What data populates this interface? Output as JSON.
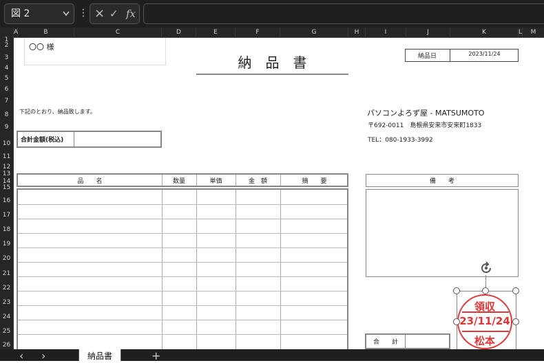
{
  "formula_bar": {
    "name_box": "図 2",
    "name_box_chevron": "chevron-down-icon",
    "more_icon": "⋮",
    "cancel_icon": "×",
    "enter_icon": "✓",
    "fx_label": "fx",
    "formula_value": ""
  },
  "columns": [
    "A",
    "B",
    "C",
    "D",
    "E",
    "F",
    "G",
    "H",
    "I",
    "J",
    "K",
    "L",
    "M"
  ],
  "rows": [
    "1",
    "2",
    "3",
    "4",
    "5",
    "6",
    "7",
    "8",
    "9",
    "10",
    "11",
    "12",
    "13",
    "14",
    "15",
    "16",
    "17",
    "18",
    "19",
    "20",
    "21",
    "22",
    "23",
    "24",
    "25",
    "26"
  ],
  "document": {
    "recipient": "〇〇 様",
    "title": "納　品　書",
    "date_label": "納品日",
    "date_value": "2023/11/24",
    "intro": "下記のとおり、納品致します。",
    "total_label": "合計金額(税込)",
    "total_value": "",
    "company": "パソコンよろず屋 - MATSUMOTO",
    "address": "〒692-0011　島根県安来市安来町1833",
    "tel": "TEL：080-1933-3992",
    "table_headers": [
      "品　　名",
      "数量",
      "単価",
      "金　額",
      "摘　　要"
    ],
    "remarks_label": "備　　考",
    "subtotal_label": "合　　計"
  },
  "stamp": {
    "top": "領収",
    "date": "23/11/24",
    "bottom": "松本",
    "color": "#e23636"
  },
  "tabs": {
    "prev": "‹",
    "next": "›",
    "active": "納品書",
    "add": "+"
  }
}
